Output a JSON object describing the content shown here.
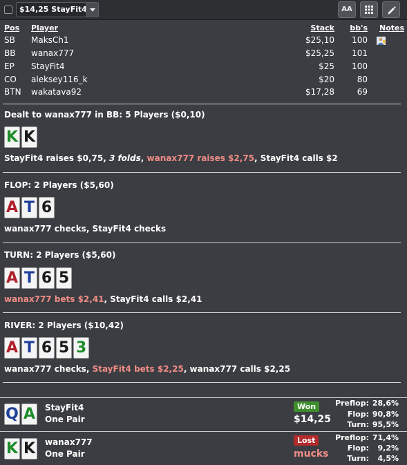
{
  "toolbar": {
    "select_value": "$14,25 StayFit4",
    "font_button_label": "AA",
    "grid_icon": "grid-icon",
    "edit_icon": "pencil-icon"
  },
  "players_table": {
    "headers": {
      "pos": "Pos",
      "player": "Player",
      "stack": "Stack",
      "bbs": "bb's",
      "notes": "Notes"
    },
    "rows": [
      {
        "pos": "SB",
        "player": "MaksCh1",
        "stack": "$25,10",
        "bbs": "100",
        "note_icon": "user-note-icon"
      },
      {
        "pos": "BB",
        "player": "wanax777",
        "stack": "$25,25",
        "bbs": "101"
      },
      {
        "pos": "EP",
        "player": "StayFit4",
        "stack": "$25",
        "bbs": "100"
      },
      {
        "pos": "CO",
        "player": "aleksey116_k",
        "stack": "$20",
        "bbs": "80"
      },
      {
        "pos": "BTN",
        "player": "wakatava92",
        "stack": "$17,28",
        "bbs": "69"
      }
    ]
  },
  "preflop": {
    "title": "Dealt to wanax777 in BB: 5 Players ($0,10)",
    "cards": [
      {
        "rank": "K",
        "color": "#1d8c2a"
      },
      {
        "rank": "K",
        "color": "#1a1a1a"
      }
    ],
    "actions": [
      {
        "text": "StayFit4 raises $0,75, ",
        "style": ""
      },
      {
        "text": "3 folds",
        "style": "it"
      },
      {
        "text": ", ",
        "style": ""
      },
      {
        "text": "wanax777 raises $2,75",
        "style": "hl"
      },
      {
        "text": ", StayFit4 calls $2",
        "style": ""
      }
    ]
  },
  "flop": {
    "title": "FLOP: 2 Players ($5,60)",
    "cards": [
      {
        "rank": "A",
        "color": "#b01f2b"
      },
      {
        "rank": "T",
        "color": "#1f3f9a"
      },
      {
        "rank": "6",
        "color": "#1a1a1a"
      }
    ],
    "actions": [
      {
        "text": "wanax777 checks, StayFit4 checks",
        "style": ""
      }
    ]
  },
  "turn": {
    "title": "TURN: 2 Players ($5,60)",
    "cards": [
      {
        "rank": "A",
        "color": "#b01f2b"
      },
      {
        "rank": "T",
        "color": "#1f3f9a"
      },
      {
        "rank": "6",
        "color": "#1a1a1a"
      },
      {
        "rank": "5",
        "color": "#1a1a1a"
      }
    ],
    "actions": [
      {
        "text": "wanax777 bets $2,41",
        "style": "hl"
      },
      {
        "text": ", StayFit4 calls $2,41",
        "style": ""
      }
    ]
  },
  "river": {
    "title": "RIVER: 2 Players ($10,42)",
    "cards": [
      {
        "rank": "A",
        "color": "#b01f2b"
      },
      {
        "rank": "T",
        "color": "#1f3f9a"
      },
      {
        "rank": "6",
        "color": "#1a1a1a"
      },
      {
        "rank": "5",
        "color": "#1a1a1a"
      },
      {
        "rank": "3",
        "color": "#1d8c2a"
      }
    ],
    "actions": [
      {
        "text": "wanax777 checks, ",
        "style": ""
      },
      {
        "text": "StayFit4 bets $2,25",
        "style": "hl"
      },
      {
        "text": ", wanax777 calls $2,25",
        "style": ""
      }
    ]
  },
  "results": [
    {
      "name": "StayFit4",
      "hand": "One Pair",
      "cards": [
        {
          "rank": "Q",
          "color": "#1f3f9a"
        },
        {
          "rank": "A",
          "color": "#1d8c2a"
        }
      ],
      "badge": "Won",
      "outcome": "$14,25",
      "stats": [
        {
          "label": "Preflop:",
          "value": "28,6%"
        },
        {
          "label": "Flop:",
          "value": "90,8%"
        },
        {
          "label": "Turn:",
          "value": "95,5%"
        }
      ]
    },
    {
      "name": "wanax777",
      "hand": "One Pair",
      "cards": [
        {
          "rank": "K",
          "color": "#1d8c2a"
        },
        {
          "rank": "K",
          "color": "#1a1a1a"
        }
      ],
      "badge": "Lost",
      "outcome": "mucks",
      "stats": [
        {
          "label": "Preflop:",
          "value": "71,4%"
        },
        {
          "label": "Flop:",
          "value": "9,2%"
        },
        {
          "label": "Turn:",
          "value": "4,5%"
        }
      ]
    }
  ],
  "colors": {
    "background": "#3b3d42",
    "highlight_action": "#f08c85",
    "won_badge": "#3f8f2f",
    "lost_badge": "#b32b2b"
  }
}
